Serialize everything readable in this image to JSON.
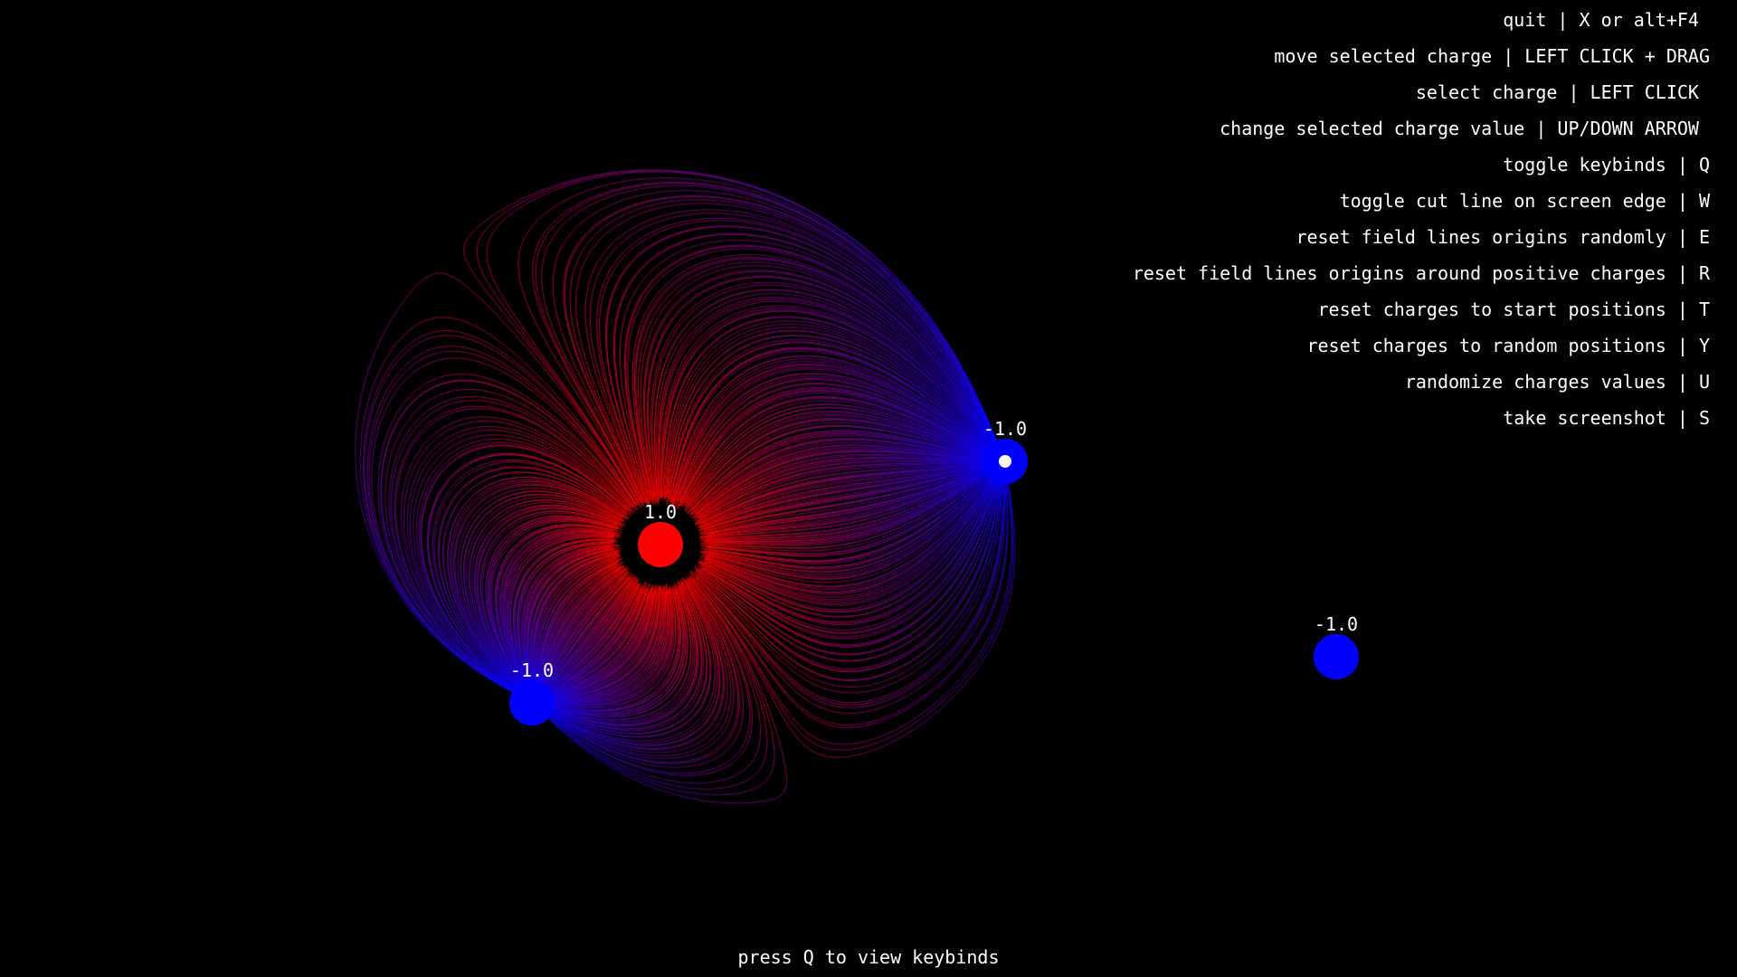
{
  "colors": {
    "background": "#000000",
    "positive": "#ff0000",
    "negative": "#0000ff",
    "text": "#ffffff"
  },
  "charges": [
    {
      "label": "1.0",
      "value": 1.0,
      "sign": "positive",
      "selected": false
    },
    {
      "label": "-1.0",
      "value": -1.0,
      "sign": "negative",
      "selected": true
    },
    {
      "label": "-1.0",
      "value": -1.0,
      "sign": "negative",
      "selected": false
    },
    {
      "label": "-1.0",
      "value": -1.0,
      "sign": "negative",
      "selected": false
    }
  ],
  "keybinds": [
    "quit | X or alt+F4 ",
    "move selected charge | LEFT CLICK + DRAG",
    "select charge | LEFT CLICK ",
    "change selected charge value | UP/DOWN ARROW ",
    "toggle keybinds | Q",
    "toggle cut line on screen edge | W",
    "reset field lines origins randomly | E",
    "reset field lines origins around positive charges | R",
    "reset charges to start positions | T",
    "reset charges to random positions | Y",
    "randomize charges values | U",
    "take screenshot | S"
  ],
  "hint": "press Q to view keybinds"
}
